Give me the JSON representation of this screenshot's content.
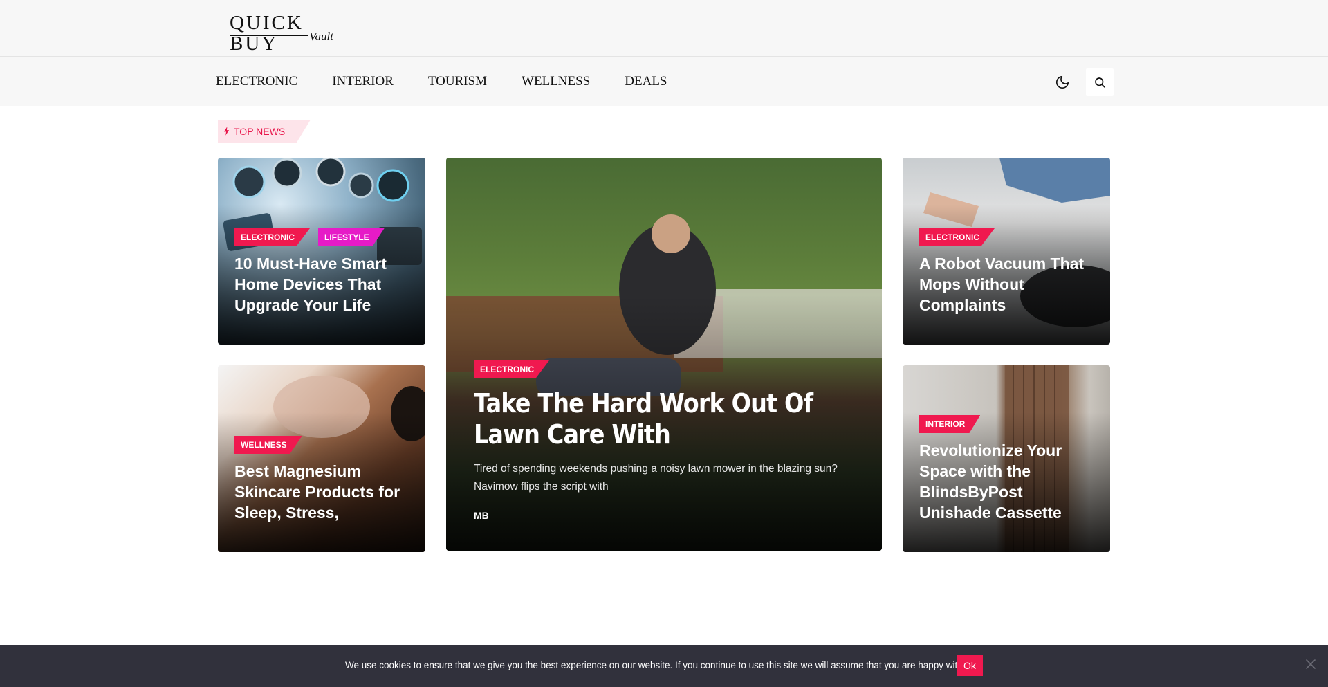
{
  "brand": {
    "name": "QUICK BUY",
    "sub": "Vault"
  },
  "nav": {
    "items": [
      {
        "label": "ELECTRONIC"
      },
      {
        "label": "INTERIOR"
      },
      {
        "label": "TOURISM"
      },
      {
        "label": "WELLNESS"
      },
      {
        "label": "DEALS"
      }
    ],
    "dark_mode_icon": "moon-icon",
    "search_icon": "search-icon"
  },
  "section": {
    "label": "TOP NEWS",
    "icon": "lightning-icon"
  },
  "cards": {
    "smart_home": {
      "tags": [
        "ELECTRONIC",
        "LIFESTYLE"
      ],
      "title": "10 Must-Have Smart Home Devices That Upgrade Your Life"
    },
    "magnesium": {
      "tags": [
        "WELLNESS"
      ],
      "title": "Best Magnesium Skincare Products for Sleep, Stress,"
    },
    "lawn": {
      "tags": [
        "ELECTRONIC"
      ],
      "title": "Take The Hard Work Out Of Lawn Care With",
      "excerpt": "Tired of spending weekends pushing a noisy lawn mower in the blazing sun? Navimow flips the script with",
      "author": "MB"
    },
    "robot": {
      "tags": [
        "ELECTRONIC"
      ],
      "title": "A Robot Vacuum That Mops Without Complaints"
    },
    "blinds": {
      "tags": [
        "INTERIOR"
      ],
      "title": "Revolutionize Your Space with the BlindsByPost Unishade Cassette"
    }
  },
  "cookie": {
    "text": "We use cookies to ensure that we give you the best experience on our website. If you continue to use this site we will assume that you are happy with it.",
    "ok_label": "Ok",
    "close_icon": "close-icon"
  },
  "colors": {
    "accent": "#f0194f",
    "lifestyle": "#e61bc7",
    "cookie_bg": "#31313c",
    "header_bg": "#f7f7f7"
  }
}
